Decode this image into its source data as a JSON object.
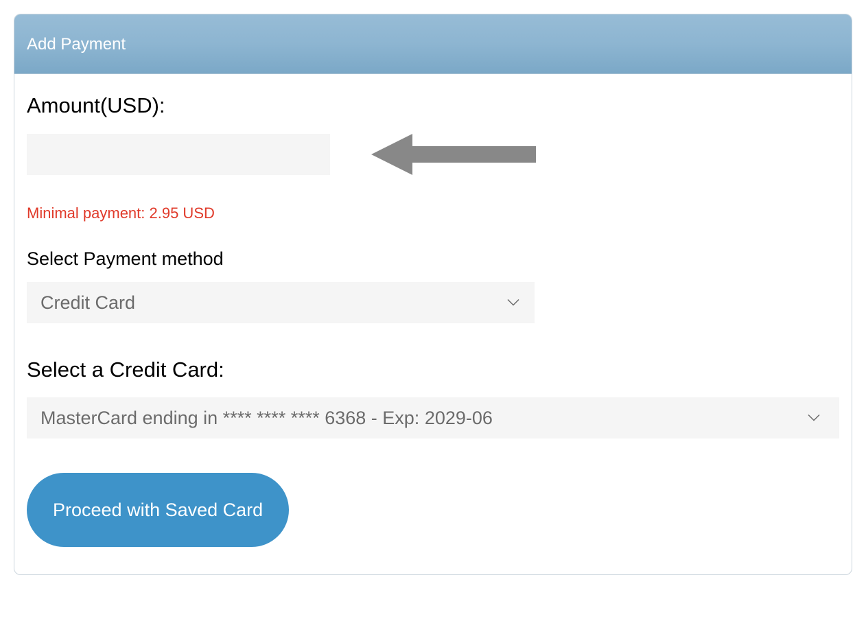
{
  "header": {
    "title": "Add Payment"
  },
  "form": {
    "amount_label": "Amount(USD):",
    "amount_value": "",
    "min_payment_text": "Minimal payment: 2.95 USD",
    "method_label": "Select Payment method",
    "method_selected": "Credit Card",
    "card_section_label": "Select a Credit Card:",
    "card_selected": "MasterCard ending in **** **** **** 6368 - Exp: 2029-06",
    "proceed_label": "Proceed with Saved Card"
  },
  "colors": {
    "header_bg": "#8db5d1",
    "error": "#e03a2a",
    "button": "#3e93c9"
  }
}
